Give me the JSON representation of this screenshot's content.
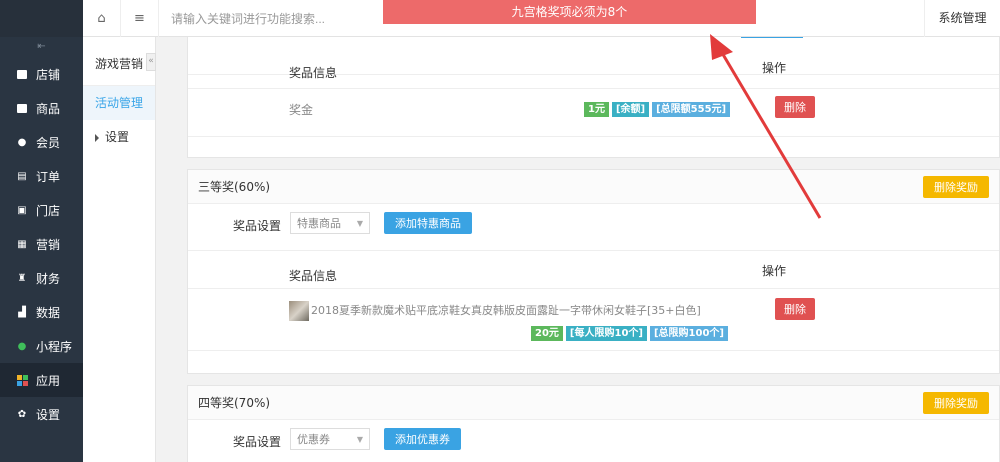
{
  "toast": {
    "message": "九宫格奖项必须为8个"
  },
  "topbar": {
    "search_placeholder": "请输入关键词进行功能搜索...",
    "system_label": "系统管理"
  },
  "sidebar": {
    "items": [
      {
        "label": "店铺",
        "icon": "store-icon"
      },
      {
        "label": "商品",
        "icon": "goods-icon"
      },
      {
        "label": "会员",
        "icon": "member-icon"
      },
      {
        "label": "订单",
        "icon": "order-icon"
      },
      {
        "label": "门店",
        "icon": "shop-icon"
      },
      {
        "label": "营销",
        "icon": "gift-icon"
      },
      {
        "label": "财务",
        "icon": "money-bag-icon"
      },
      {
        "label": "数据",
        "icon": "chart-icon"
      },
      {
        "label": "小程序",
        "icon": "miniprogram-icon"
      },
      {
        "label": "应用",
        "icon": "apps-icon"
      },
      {
        "label": "设置",
        "icon": "gear-icon"
      }
    ]
  },
  "submenu": {
    "title": "游戏营销",
    "items": [
      {
        "label": "活动管理"
      },
      {
        "label": "设置"
      }
    ]
  },
  "prize_top": {
    "col_info": "奖品信息",
    "col_action": "操作",
    "row_name": "奖金",
    "tags": [
      "1元",
      "[余额]",
      "[总限额555元]"
    ],
    "delete_label": "删除"
  },
  "prize3": {
    "title": "三等奖(60%)",
    "delete_prize_label": "删除奖励",
    "setting_label": "奖品设置",
    "select_value": "特惠商品",
    "add_label": "添加特惠商品",
    "col_info": "奖品信息",
    "col_action": "操作",
    "product_name": "2018夏季新款魔术贴平底凉鞋女真皮韩版皮面露趾一字带休闲女鞋子[35+白色]",
    "tags": [
      "20元",
      "[每人限购10个]",
      "[总限购100个]"
    ],
    "delete_label": "删除"
  },
  "prize4": {
    "title": "四等奖(70%)",
    "delete_prize_label": "删除奖励",
    "setting_label": "奖品设置",
    "select_value": "优惠券",
    "add_label": "添加优惠券"
  },
  "colors": {
    "sidebar_bg": "#2a3542",
    "toast_bg": "#ed6a6a",
    "accent_blue": "#3aa3e3",
    "warning_yellow": "#f5b800",
    "danger_red": "#e05151",
    "arrow_red": "#e23b3b"
  }
}
